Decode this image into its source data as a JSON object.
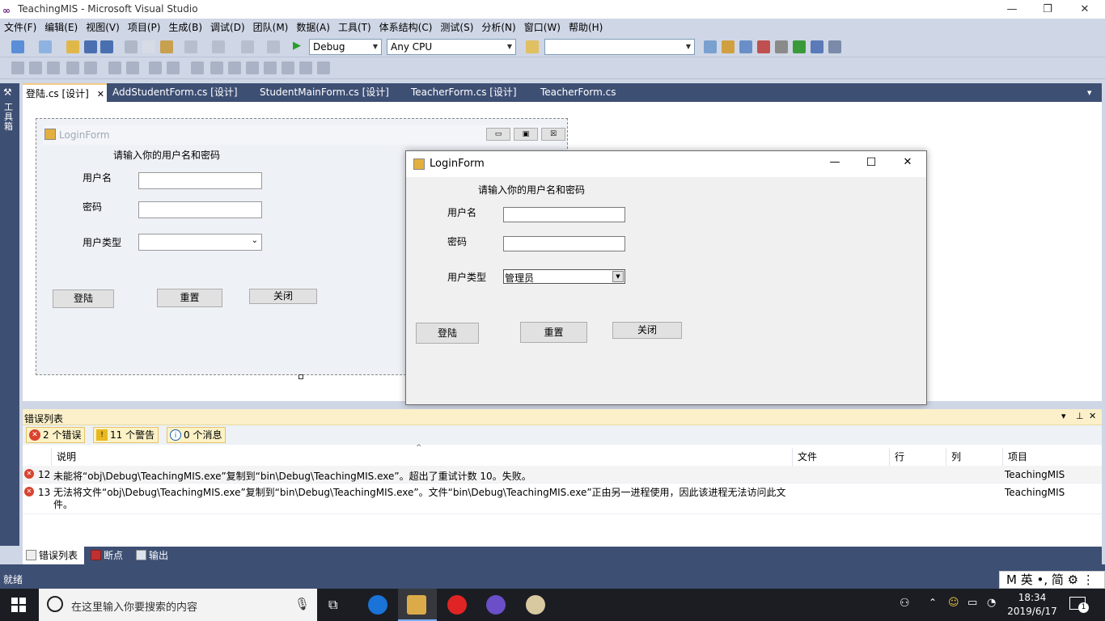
{
  "window": {
    "title": "TeachingMIS - Microsoft Visual Studio",
    "minimize": "—",
    "restore": "❐",
    "close": "✕"
  },
  "menu": [
    "文件(F)",
    "编辑(E)",
    "视图(V)",
    "项目(P)",
    "生成(B)",
    "调试(D)",
    "团队(M)",
    "数据(A)",
    "工具(T)",
    "体系结构(C)",
    "测试(S)",
    "分析(N)",
    "窗口(W)",
    "帮助(H)"
  ],
  "toolbar": {
    "config": "Debug",
    "platform": "Any CPU",
    "find_value": ""
  },
  "toolbox": {
    "label": "工具箱"
  },
  "tabs": [
    {
      "label": "登陆.cs [设计]",
      "active": true,
      "close": "✕"
    },
    {
      "label": "AddStudentForm.cs [设计]",
      "active": false
    },
    {
      "label": "StudentMainForm.cs [设计]",
      "active": false
    },
    {
      "label": "TeacherForm.cs [设计]",
      "active": false
    },
    {
      "label": "TeacherForm.cs",
      "active": false
    }
  ],
  "tab_overflow": "▾",
  "design_form": {
    "title": "LoginForm",
    "prompt": "请输入你的用户名和密码",
    "username_label": "用户名",
    "password_label": "密码",
    "usertype_label": "用户类型",
    "usertype_value": "",
    "login": "登陆",
    "reset": "重置",
    "close": "关闭",
    "win_min": "▭",
    "win_max": "▣",
    "win_close": "☒"
  },
  "run_form": {
    "title": "LoginForm",
    "prompt": "请输入你的用户名和密码",
    "username_label": "用户名",
    "password_label": "密码",
    "usertype_label": "用户类型",
    "usertype_value": "管理员",
    "login": "登陆",
    "reset": "重置",
    "close": "关闭",
    "win_min": "—",
    "win_max": "☐",
    "win_close": "✕"
  },
  "error_list": {
    "title": "错误列表",
    "header_controls": [
      "▾",
      "⊥",
      "✕"
    ],
    "filters": {
      "errors": "2 个错误",
      "warnings": "11 个警告",
      "messages": "0 个消息"
    },
    "columns": [
      "说明",
      "文件",
      "行",
      "列",
      "项目"
    ],
    "rows": [
      {
        "num": "12",
        "desc": "未能将“obj\\Debug\\TeachingMIS.exe”复制到“bin\\Debug\\TeachingMIS.exe”。超出了重试计数 10。失败。",
        "file": "",
        "line": "",
        "col": "",
        "project": "TeachingMIS"
      },
      {
        "num": "13",
        "desc": "无法将文件“obj\\Debug\\TeachingMIS.exe”复制到“bin\\Debug\\TeachingMIS.exe”。文件“bin\\Debug\\TeachingMIS.exe”正由另一进程使用，因此该进程无法访问此文件。",
        "file": "",
        "line": "",
        "col": "",
        "project": "TeachingMIS"
      }
    ]
  },
  "bottom_tabs": [
    "错误列表",
    "断点",
    "输出"
  ],
  "status": "就绪",
  "ime": "M 英 •, 简 ⚙ ⋮",
  "taskbar": {
    "search_placeholder": "在这里输入你要搜索的内容",
    "time": "18:34",
    "date": "2019/6/17",
    "notif_count": "1"
  },
  "colors": {
    "vs_dark": "#3e4f74",
    "vs_light": "#cfd6e5",
    "error": "#d9432f",
    "tab_highlight": "#f5cc84"
  }
}
